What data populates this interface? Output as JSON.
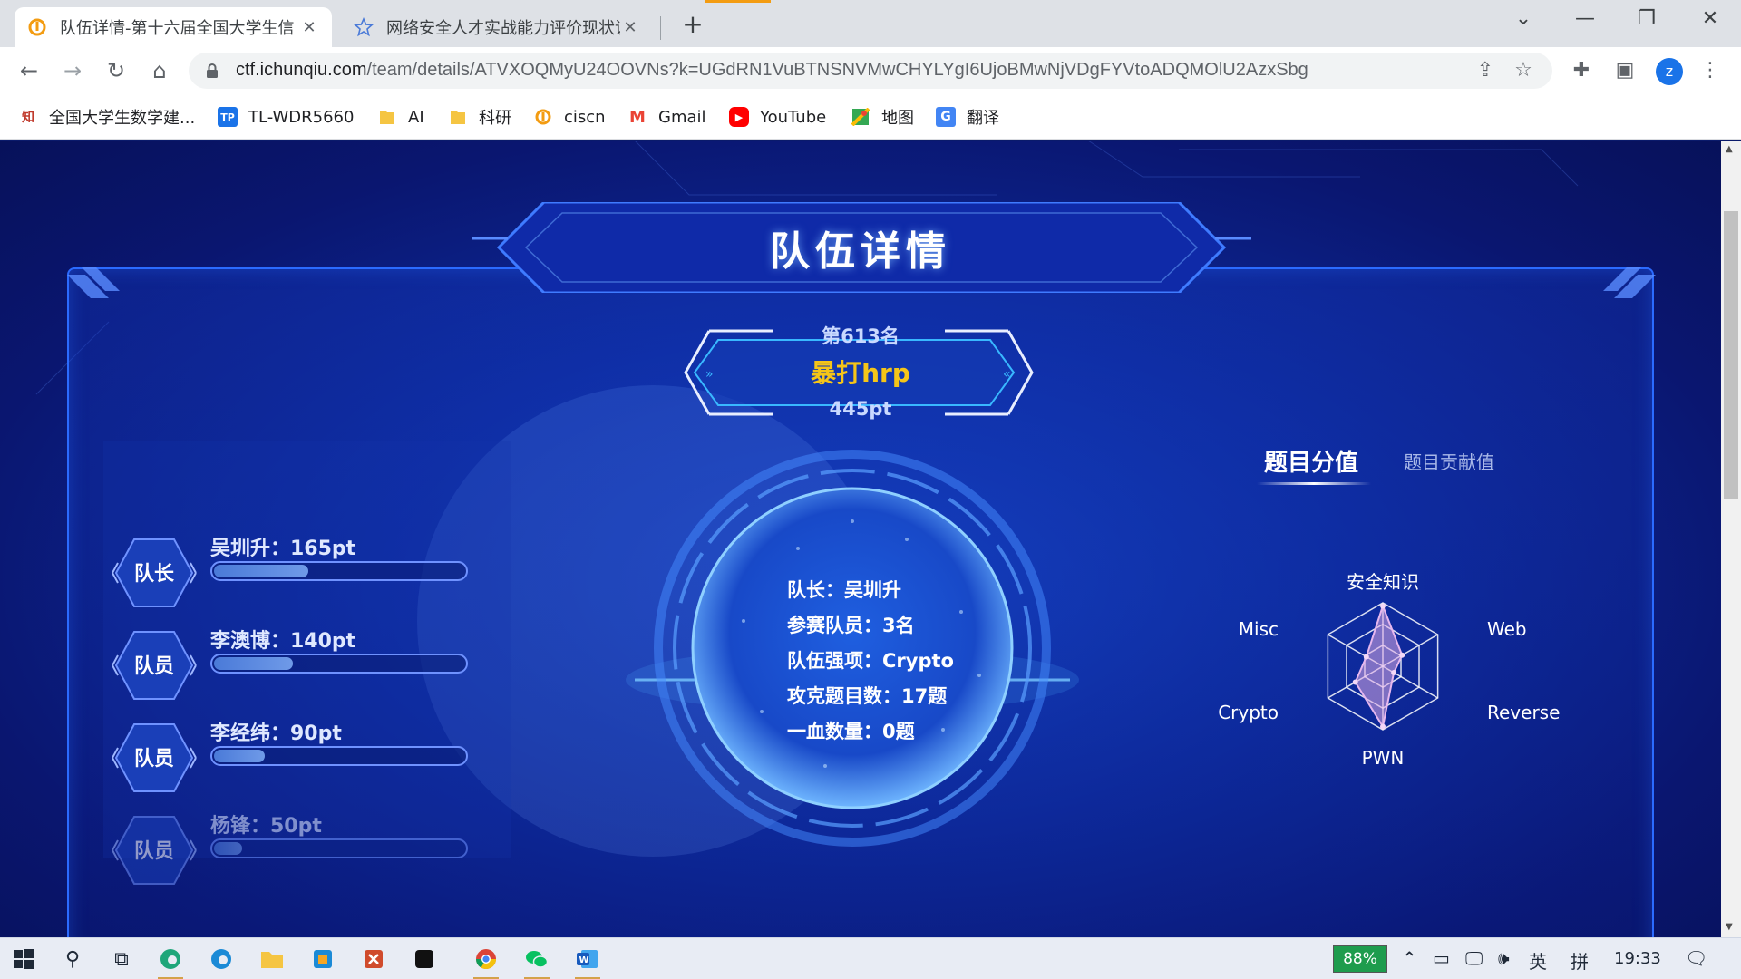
{
  "browser": {
    "tabs": [
      {
        "title": "队伍详情-第十六届全国大学生信",
        "close": "✕"
      },
      {
        "title": "网络安全人才实战能力评价现状调",
        "close": "✕"
      }
    ],
    "new_tab": "+",
    "url": {
      "host": "ctf.ichunqiu.com",
      "path": "/team/details/ATVXOQMyU24OOVNs?k=UGdRN1VuBTNSNVMwCHYLYgI6UjoBMwNjVDgFYVtoADQMOlU2AzxSbg"
    },
    "profile_initial": "z",
    "bookmarks": [
      {
        "label": "全国大学生数学建...",
        "icon": "zhi-icon",
        "color": "#c0392b",
        "glyph": "知"
      },
      {
        "label": "TL-WDR5660",
        "icon": "tplink-icon",
        "color": "#1a73e8",
        "glyph": "TP"
      },
      {
        "label": "AI",
        "icon": "folder-icon",
        "color": "#f5c542",
        "glyph": ""
      },
      {
        "label": "科研",
        "icon": "folder-icon",
        "color": "#f5c542",
        "glyph": ""
      },
      {
        "label": "ciscn",
        "icon": "ichunqiu-icon",
        "color": "#f39c12",
        "glyph": ""
      },
      {
        "label": "Gmail",
        "icon": "gmail-icon",
        "color": "#ea4335",
        "glyph": "M"
      },
      {
        "label": "YouTube",
        "icon": "youtube-icon",
        "color": "#ff0000",
        "glyph": "▶"
      },
      {
        "label": "地图",
        "icon": "maps-icon",
        "color": "#34a853",
        "glyph": ""
      },
      {
        "label": "翻译",
        "icon": "translate-icon",
        "color": "#4285f4",
        "glyph": "G"
      }
    ]
  },
  "page": {
    "title": "队伍详情",
    "rank": "第613名",
    "team_name": "暴打hrp",
    "score": "445pt",
    "members": [
      {
        "role": "队长",
        "name": "吴圳升：165pt",
        "progress": 0.37
      },
      {
        "role": "队员",
        "name": "李澳博：140pt",
        "progress": 0.31
      },
      {
        "role": "队员",
        "name": "李经纬：90pt",
        "progress": 0.2
      },
      {
        "role": "队员",
        "name": "杨锋：50pt",
        "progress": 0.11
      }
    ],
    "info": [
      "队长：吴圳升",
      "参赛队员：3名",
      "队伍强项：Crypto",
      "攻克题目数：17题",
      "一血数量：0题"
    ],
    "tabs": {
      "active": "题目分值",
      "inactive": "题目贡献值"
    },
    "radar": {
      "axes": [
        "安全知识",
        "Web",
        "Reverse",
        "PWN",
        "Crypto",
        "Misc"
      ],
      "values": [
        0.95,
        0.35,
        0.2,
        0.95,
        0.5,
        0.3
      ]
    }
  },
  "taskbar": {
    "battery": "88%",
    "ime_lang": "英",
    "ime_mode": "拼",
    "time": "19:33"
  }
}
